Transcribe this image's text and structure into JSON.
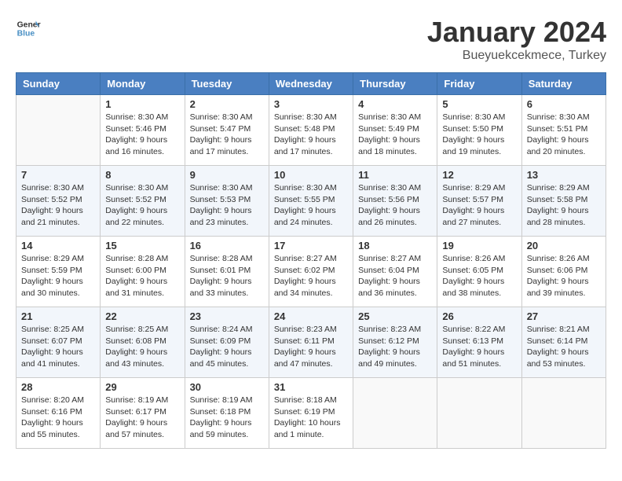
{
  "header": {
    "logo_line1": "General",
    "logo_line2": "Blue",
    "month_title": "January 2024",
    "location": "Bueyuekcekmece, Turkey"
  },
  "days_of_week": [
    "Sunday",
    "Monday",
    "Tuesday",
    "Wednesday",
    "Thursday",
    "Friday",
    "Saturday"
  ],
  "weeks": [
    {
      "days": [
        {
          "number": "",
          "info": ""
        },
        {
          "number": "1",
          "info": "Sunrise: 8:30 AM\nSunset: 5:46 PM\nDaylight: 9 hours\nand 16 minutes."
        },
        {
          "number": "2",
          "info": "Sunrise: 8:30 AM\nSunset: 5:47 PM\nDaylight: 9 hours\nand 17 minutes."
        },
        {
          "number": "3",
          "info": "Sunrise: 8:30 AM\nSunset: 5:48 PM\nDaylight: 9 hours\nand 17 minutes."
        },
        {
          "number": "4",
          "info": "Sunrise: 8:30 AM\nSunset: 5:49 PM\nDaylight: 9 hours\nand 18 minutes."
        },
        {
          "number": "5",
          "info": "Sunrise: 8:30 AM\nSunset: 5:50 PM\nDaylight: 9 hours\nand 19 minutes."
        },
        {
          "number": "6",
          "info": "Sunrise: 8:30 AM\nSunset: 5:51 PM\nDaylight: 9 hours\nand 20 minutes."
        }
      ]
    },
    {
      "days": [
        {
          "number": "7",
          "info": ""
        },
        {
          "number": "8",
          "info": "Sunrise: 8:30 AM\nSunset: 5:52 PM\nDaylight: 9 hours\nand 22 minutes."
        },
        {
          "number": "9",
          "info": "Sunrise: 8:30 AM\nSunset: 5:53 PM\nDaylight: 9 hours\nand 23 minutes."
        },
        {
          "number": "10",
          "info": "Sunrise: 8:30 AM\nSunset: 5:55 PM\nDaylight: 9 hours\nand 24 minutes."
        },
        {
          "number": "11",
          "info": "Sunrise: 8:30 AM\nSunset: 5:56 PM\nDaylight: 9 hours\nand 26 minutes."
        },
        {
          "number": "12",
          "info": "Sunrise: 8:29 AM\nSunset: 5:57 PM\nDaylight: 9 hours\nand 27 minutes."
        },
        {
          "number": "13",
          "info": "Sunrise: 8:29 AM\nSunset: 5:58 PM\nDaylight: 9 hours\nand 28 minutes."
        }
      ]
    },
    {
      "days": [
        {
          "number": "14",
          "info": ""
        },
        {
          "number": "15",
          "info": "Sunrise: 8:28 AM\nSunset: 6:00 PM\nDaylight: 9 hours\nand 31 minutes."
        },
        {
          "number": "16",
          "info": "Sunrise: 8:28 AM\nSunset: 6:01 PM\nDaylight: 9 hours\nand 33 minutes."
        },
        {
          "number": "17",
          "info": "Sunrise: 8:27 AM\nSunset: 6:02 PM\nDaylight: 9 hours\nand 34 minutes."
        },
        {
          "number": "18",
          "info": "Sunrise: 8:27 AM\nSunset: 6:04 PM\nDaylight: 9 hours\nand 36 minutes."
        },
        {
          "number": "19",
          "info": "Sunrise: 8:26 AM\nSunset: 6:05 PM\nDaylight: 9 hours\nand 38 minutes."
        },
        {
          "number": "20",
          "info": "Sunrise: 8:26 AM\nSunset: 6:06 PM\nDaylight: 9 hours\nand 39 minutes."
        }
      ]
    },
    {
      "days": [
        {
          "number": "21",
          "info": ""
        },
        {
          "number": "22",
          "info": "Sunrise: 8:25 AM\nSunset: 6:08 PM\nDaylight: 9 hours\nand 43 minutes."
        },
        {
          "number": "23",
          "info": "Sunrise: 8:24 AM\nSunset: 6:09 PM\nDaylight: 9 hours\nand 45 minutes."
        },
        {
          "number": "24",
          "info": "Sunrise: 8:23 AM\nSunset: 6:11 PM\nDaylight: 9 hours\nand 47 minutes."
        },
        {
          "number": "25",
          "info": "Sunrise: 8:23 AM\nSunset: 6:12 PM\nDaylight: 9 hours\nand 49 minutes."
        },
        {
          "number": "26",
          "info": "Sunrise: 8:22 AM\nSunset: 6:13 PM\nDaylight: 9 hours\nand 51 minutes."
        },
        {
          "number": "27",
          "info": "Sunrise: 8:21 AM\nSunset: 6:14 PM\nDaylight: 9 hours\nand 53 minutes."
        }
      ]
    },
    {
      "days": [
        {
          "number": "28",
          "info": "Sunrise: 8:20 AM\nSunset: 6:16 PM\nDaylight: 9 hours\nand 55 minutes."
        },
        {
          "number": "29",
          "info": "Sunrise: 8:19 AM\nSunset: 6:17 PM\nDaylight: 9 hours\nand 57 minutes."
        },
        {
          "number": "30",
          "info": "Sunrise: 8:19 AM\nSunset: 6:18 PM\nDaylight: 9 hours\nand 59 minutes."
        },
        {
          "number": "31",
          "info": "Sunrise: 8:18 AM\nSunset: 6:19 PM\nDaylight: 10 hours\nand 1 minute."
        },
        {
          "number": "",
          "info": ""
        },
        {
          "number": "",
          "info": ""
        },
        {
          "number": "",
          "info": ""
        }
      ]
    }
  ],
  "week1_sun_info": "Sunrise: 8:30 AM\nSunset: 5:52 PM\nDaylight: 9 hours\nand 21 minutes.",
  "week3_sun_info": "Sunrise: 8:29 AM\nSunset: 5:59 PM\nDaylight: 9 hours\nand 30 minutes.",
  "week4_sun_info": "Sunrise: 8:25 AM\nSunset: 6:07 PM\nDaylight: 9 hours\nand 41 minutes."
}
